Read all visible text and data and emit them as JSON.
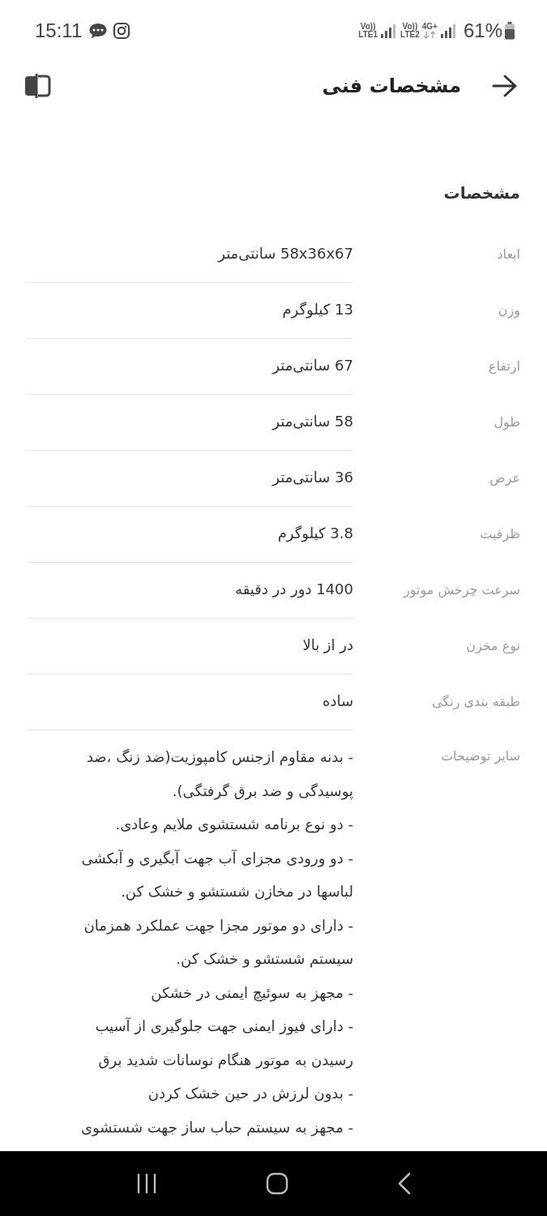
{
  "status_bar": {
    "time": "15:11",
    "sim_1": {
      "top": "Vo))",
      "bottom": "LTE1"
    },
    "sim_2": {
      "top": "Vo))",
      "bottom": "LTE2"
    },
    "network": "4G+",
    "battery": "61%"
  },
  "header": {
    "title": "مشخصات فنی"
  },
  "section": {
    "title": "مشخصات"
  },
  "specs": [
    {
      "label": "ابعاد",
      "value": "58x36x67 سانتی‌متر"
    },
    {
      "label": "وزن",
      "value": "13 کیلوگرم"
    },
    {
      "label": "ارتفاع",
      "value": "67 سانتی‌متر"
    },
    {
      "label": "طول",
      "value": "58 سانتی‌متر"
    },
    {
      "label": "عرض",
      "value": "36 سانتی‌متر"
    },
    {
      "label": "ظرفیت",
      "value": "3.8 کیلوگرم"
    },
    {
      "label": "سرعت چرخش موتور",
      "value": "1400 دور در دقیقه"
    },
    {
      "label": "نوع مخزن",
      "value": "در از بالا"
    },
    {
      "label": "طبقه بندی رنگی",
      "value": "ساده"
    }
  ],
  "other": {
    "label": "سایر توضیحات",
    "lines": [
      "- بدنه مقاوم ازجنس کامپوزیت(ضد زنگ ،ضد",
      "پوسیدگی و ضد برق گرفتگی).",
      "- دو نوع برنامه شستشوی ملایم وعادی.",
      "- دو ورودی مجزای آب جهت آبگیری و آبکشی",
      "لباسها در مخازن شستشو و خشک کن.",
      "- دارای دو موتور مجزا جهت عملکرد همزمان",
      "سیستم شستشو و خشک کن.",
      "- مجهز به سوئیچ ایمنی در خشکن",
      "- دارای فیوز ایمنی جهت جلوگیری از آسیب",
      "رسیدن به موتور هنگام نوسانات شدید برق",
      "- بدون لرزش در حین خشک کردن",
      "- مجهز به سیستم حباب ساز جهت شستشوی"
    ]
  }
}
